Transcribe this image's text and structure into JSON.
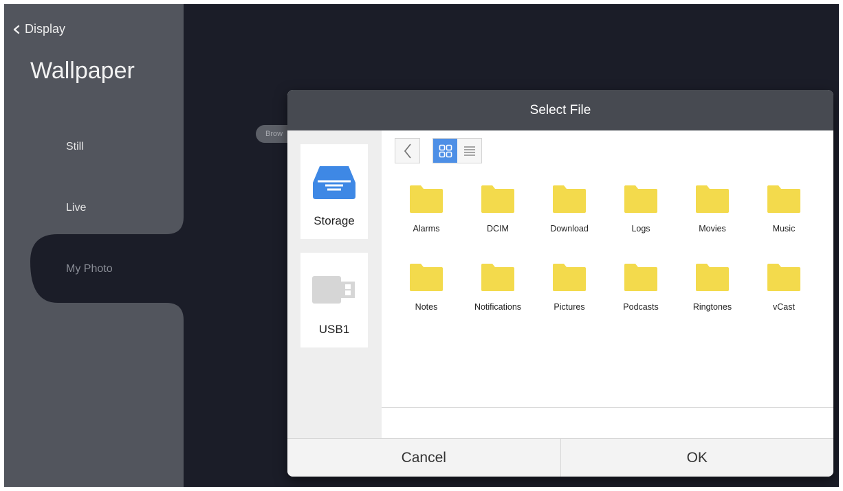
{
  "sidebar": {
    "back_label": "Display",
    "title": "Wallpaper",
    "items": [
      {
        "label": "Still"
      },
      {
        "label": "Live"
      },
      {
        "label": "My Photo"
      }
    ]
  },
  "background": {
    "browse_chip_label": "Brow"
  },
  "dialog": {
    "title": "Select File",
    "sources": [
      {
        "label": "Storage",
        "icon": "storage-drive-icon"
      },
      {
        "label": "USB1",
        "icon": "usb-drive-icon"
      }
    ],
    "view_mode": "grid",
    "folders": [
      "Alarms",
      "DCIM",
      "Download",
      "Logs",
      "Movies",
      "Music",
      "Notes",
      "Notifications",
      "Pictures",
      "Podcasts",
      "Ringtones",
      "vCast"
    ],
    "cancel_label": "Cancel",
    "ok_label": "OK"
  },
  "colors": {
    "background": "#1b1d28",
    "sidebar": "#52555d",
    "dialog_header": "#474a51",
    "folder": "#f3da4c",
    "accent": "#4d8fe6",
    "storage_icon": "#3e88e5"
  }
}
